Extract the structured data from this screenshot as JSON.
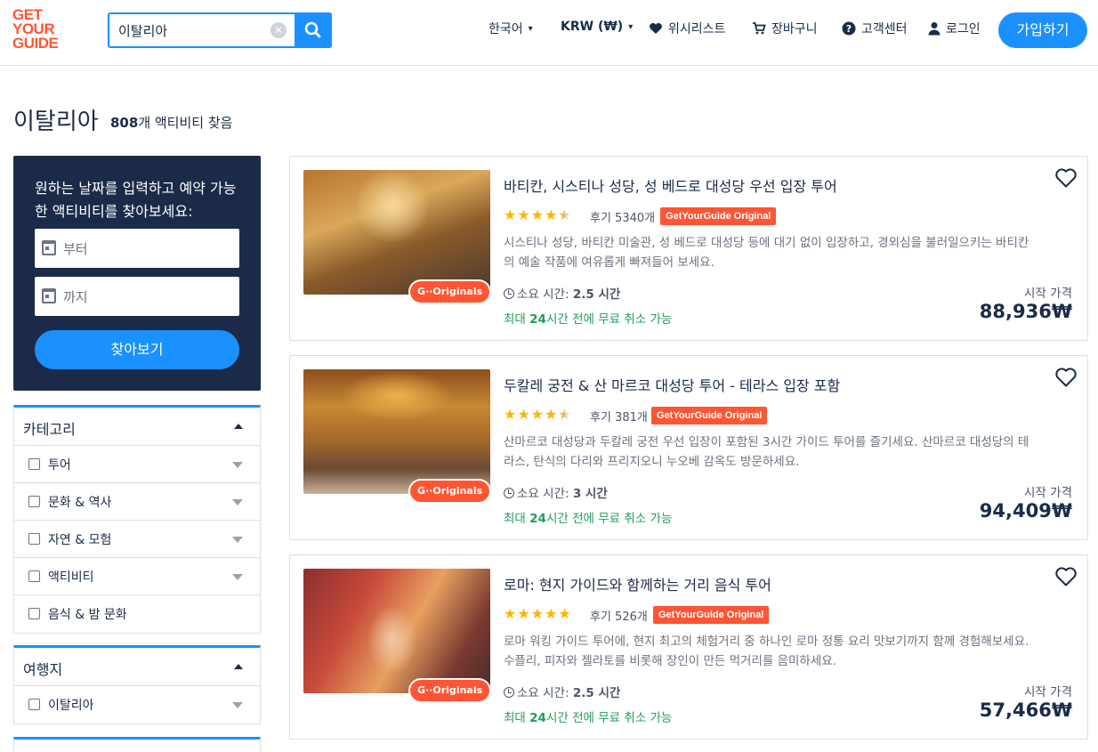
{
  "header": {
    "logo_lines": [
      "GET",
      "YOUR",
      "GUIDE"
    ],
    "search_value": "이탈리아",
    "language": "한국어",
    "currency": "KRW (₩)",
    "wishlist": "위시리스트",
    "cart": "장바구니",
    "help": "고객센터",
    "login": "로그인",
    "signup": "가입하기"
  },
  "page": {
    "title": "이탈리아",
    "count_number": "808",
    "count_suffix": "개 액티비티 찾음"
  },
  "datebox": {
    "heading": "원하는 날짜를 입력하고 예약 가능한 액티비티를 찾아보세요:",
    "from_placeholder": "부터",
    "to_placeholder": "까지",
    "button": "찾아보기"
  },
  "filters": {
    "category": {
      "title": "카테고리",
      "items": [
        "투어",
        "문화 & 역사",
        "자연 & 모험",
        "액티비티",
        "음식 & 밤 문화"
      ]
    },
    "destination": {
      "title": "여행지",
      "items": [
        "이탈리아"
      ]
    }
  },
  "cards": [
    {
      "title": "바티칸, 시스티나 성당, 성 베드로 대성당 우선 입장 투어",
      "rating": 4.5,
      "reviews": "후기 5340개",
      "original_tag": "GetYourGuide Original",
      "badge": "G··Originals",
      "description": "시스티나 성당, 바티칸 미술관, 성 베드로 대성당 등에 대기 없이 입장하고, 경외심을 불러일으키는 바티칸의 예술 작품에 여유롭게 빠져들어 보세요.",
      "duration_label": "소요 시간:",
      "duration_value": "2.5 시간",
      "cancel_prefix": "최대 ",
      "cancel_hours": "24",
      "cancel_suffix": "시간 전에 무료 취소 가능",
      "from_label": "시작 가격",
      "price": "88,936₩"
    },
    {
      "title": "두칼레 궁전 & 산 마르코 대성당 투어 - 테라스 입장 포함",
      "rating": 4.5,
      "reviews": "후기 381개",
      "original_tag": "GetYourGuide Original",
      "badge": "G··Originals",
      "description": "산마르코 대성당과 두칼레 궁전 우선 입장이 포함된 3시간 가이드 투어를 즐기세요. 산마르코 대성당의 테라스, 탄식의 다리와 프리지오니 누오베 감옥도 방문하세요.",
      "duration_label": "소요 시간:",
      "duration_value": "3 시간",
      "cancel_prefix": "최대 ",
      "cancel_hours": "24",
      "cancel_suffix": "시간 전에 무료 취소 가능",
      "from_label": "시작 가격",
      "price": "94,409₩"
    },
    {
      "title": "로마: 현지 가이드와 함께하는 거리 음식 투어",
      "rating": 5,
      "reviews": "후기 526개",
      "original_tag": "GetYourGuide Original",
      "badge": "G··Originals",
      "description": "로마 워킹 가이드 투어에, 현지 최고의 체험거리 중 하나인 로마 정통 요리 맛보기까지 함께 경험해보세요. 수플리, 피자와 젤라토를 비롯해 장인이 만든 먹거리를 음미하세요.",
      "duration_label": "소요 시간:",
      "duration_value": "2.5 시간",
      "cancel_prefix": "최대 ",
      "cancel_hours": "24",
      "cancel_suffix": "시간 전에 무료 취소 가능",
      "from_label": "시작 가격",
      "price": "57,466₩"
    }
  ],
  "colors": {
    "accent": "#1a91ff",
    "brand": "#ff5533",
    "navy": "#1b2a48",
    "star": "#ffb400",
    "free_cancel": "#1c9e5a"
  },
  "icons": {
    "search": "search-icon",
    "clear": "clear-icon",
    "heart": "heart-icon",
    "cart": "cart-icon",
    "help": "help-icon",
    "user": "user-icon",
    "calendar": "calendar-icon",
    "clock": "clock-icon",
    "chevron": "chevron-down-icon"
  }
}
